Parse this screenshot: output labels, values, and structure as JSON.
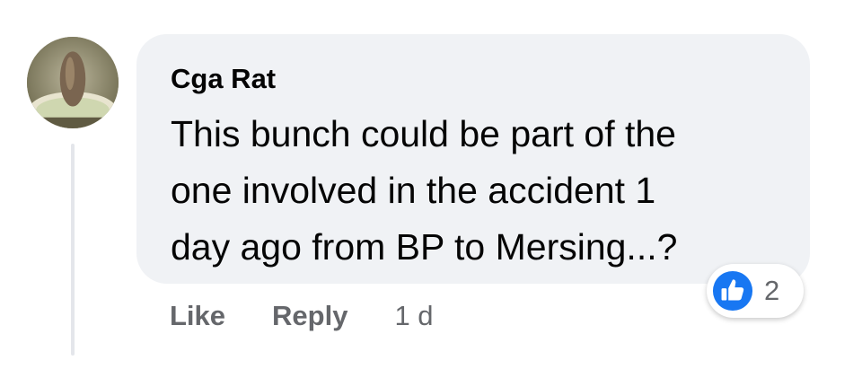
{
  "comment": {
    "author": "Cga Rat",
    "text_lines": [
      "This bunch could be part of the",
      "one involved in the accident 1",
      "day ago from BP to Mersing...?"
    ],
    "reactions": {
      "icon": "thumbs-up-icon",
      "count": "2",
      "color": "#1877f2"
    },
    "actions": {
      "like_label": "Like",
      "reply_label": "Reply",
      "timestamp": "1 d"
    }
  },
  "colors": {
    "bubble_bg": "#f0f2f5",
    "secondary_text": "#65676b",
    "primary_text": "#050505"
  }
}
